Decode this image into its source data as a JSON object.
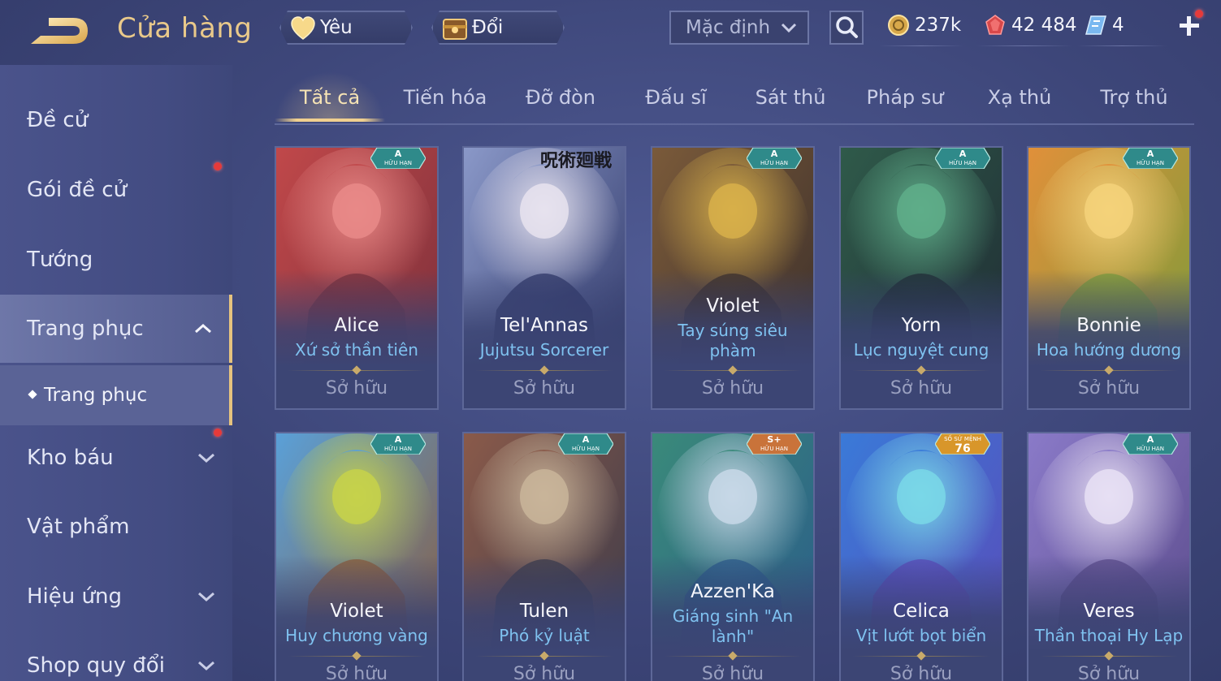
{
  "header": {
    "title": "Cửa hàng",
    "favorites_label": "Yêu thích",
    "shards_label": "Đổi mảnh",
    "sort_value": "Mặc định",
    "currencies": {
      "gold": "237k",
      "ruby": "42 484",
      "voucher": "4"
    }
  },
  "sidebar": {
    "items": [
      {
        "label": "Đề cử"
      },
      {
        "label": "Gói đề cử"
      },
      {
        "label": "Tướng"
      },
      {
        "label": "Trang phục"
      },
      {
        "label": "Trang phục"
      },
      {
        "label": "Kho báu"
      },
      {
        "label": "Vật phẩm"
      },
      {
        "label": "Hiệu ứng"
      },
      {
        "label": "Shop quy đổi"
      }
    ]
  },
  "tabs": [
    {
      "label": "Tất cả"
    },
    {
      "label": "Tiến hóa"
    },
    {
      "label": "Đỡ đòn"
    },
    {
      "label": "Đấu sĩ"
    },
    {
      "label": "Sát thủ"
    },
    {
      "label": "Pháp sư"
    },
    {
      "label": "Xạ thủ"
    },
    {
      "label": "Trợ thủ"
    }
  ],
  "cards": [
    {
      "hero": "Alice",
      "skin": "Xứ sở thần tiên",
      "status": "Sở hữu",
      "badge_top": "A",
      "badge_bottom": "HỮU HẠN",
      "palette": [
        "#c0484a",
        "#e98a88",
        "#7a2f3a"
      ]
    },
    {
      "hero": "Tel'Annas",
      "skin": "Jujutsu Sorcerer",
      "status": "Sở hữu",
      "badge_top": "",
      "badge_bottom": "",
      "banner": "呪術廻戦",
      "palette": [
        "#8a98c8",
        "#e7e3ef",
        "#2d3566"
      ]
    },
    {
      "hero": "Violet",
      "skin": "Tay súng siêu phàm",
      "status": "Sở hữu",
      "badge_top": "A",
      "badge_bottom": "HỮU HẠN",
      "palette": [
        "#7a5a3a",
        "#d8b04a",
        "#3a2e2a"
      ]
    },
    {
      "hero": "Yorn",
      "skin": "Lục nguyệt cung",
      "status": "Sở hữu",
      "badge_top": "A",
      "badge_bottom": "HỮU HẠN",
      "palette": [
        "#2f5a4a",
        "#5fae8a",
        "#1f2b33"
      ]
    },
    {
      "hero": "Bonnie",
      "skin": "Hoa hướng dương",
      "status": "Sở hữu",
      "badge_top": "A",
      "badge_bottom": "HỮU HẠN",
      "palette": [
        "#e0903a",
        "#f4d27a",
        "#7a9c3a"
      ]
    },
    {
      "hero": "Violet",
      "skin": "Huy chương vàng",
      "status": "Sở hữu",
      "badge_top": "A",
      "badge_bottom": "HỮU HẠN",
      "palette": [
        "#5aa0d8",
        "#c7d24a",
        "#8a5a3a"
      ]
    },
    {
      "hero": "Tulen",
      "skin": "Phó kỷ luật",
      "status": "Sở hữu",
      "badge_top": "A",
      "badge_bottom": "HỮU HẠN",
      "palette": [
        "#8a5a4a",
        "#c9b59a",
        "#3a3a4a"
      ]
    },
    {
      "hero": "Azzen'Ka",
      "skin": "Giáng sinh \"An lành\"",
      "status": "Sở hữu",
      "badge_top": "S+",
      "badge_bottom": "HỮU HẠN",
      "palette": [
        "#3a8a7a",
        "#c8d8e8",
        "#2a5a8a"
      ]
    },
    {
      "hero": "Celica",
      "skin": "Vịt lướt bọt biển",
      "status": "Sở hữu",
      "badge_top": "76",
      "badge_bottom": "SỐ SỨ MỆNH",
      "palette": [
        "#3a7ad8",
        "#7ad8e8",
        "#5a4ab8"
      ]
    },
    {
      "hero": "Veres",
      "skin": "Thần thoại Hy Lạp",
      "status": "Sở hữu",
      "badge_top": "A",
      "badge_bottom": "HỮU HẠN",
      "palette": [
        "#8a7ac8",
        "#e8e0f4",
        "#5a4a8a"
      ]
    }
  ],
  "colors": {
    "gold_accent": "#e9c98a",
    "skin_name": "#7fc2f0",
    "notification_dot": "#e63a3a"
  }
}
